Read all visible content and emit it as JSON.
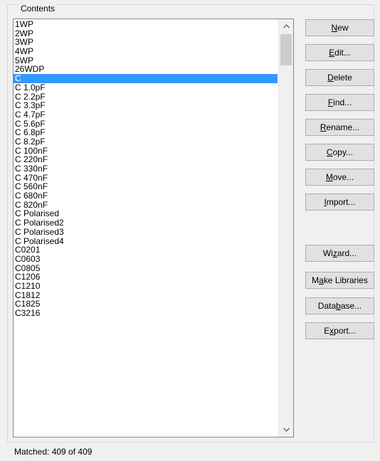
{
  "group": {
    "title": "Contents"
  },
  "list": {
    "items": [
      "1WP",
      "2WP",
      "3WP",
      "4WP",
      "5WP",
      "26WDP",
      "C",
      "C 1.0pF",
      "C 2.2pF",
      "C 3.3pF",
      "C 4.7pF",
      "C 5.6pF",
      "C 6.8pF",
      "C 8.2pF",
      "C 100nF",
      "C 220nF",
      "C 330nF",
      "C 470nF",
      "C 560nF",
      "C 680nF",
      "C 820nF",
      "C Polarised",
      "C Polarised2",
      "C Polarised3",
      "C Polarised4",
      "C0201",
      "C0603",
      "C0805",
      "C1206",
      "C1210",
      "C1812",
      "C1825",
      "C3216"
    ],
    "selected_index": 6,
    "selected_color": "#3399ff"
  },
  "scrollbar": {
    "up_icon": "chevron-up-icon",
    "down_icon": "chevron-down-icon"
  },
  "buttons": [
    {
      "pre": "",
      "acc": "N",
      "post": "ew"
    },
    {
      "pre": "",
      "acc": "E",
      "post": "dit..."
    },
    {
      "pre": "",
      "acc": "D",
      "post": "elete"
    },
    {
      "pre": "",
      "acc": "F",
      "post": "ind..."
    },
    {
      "pre": "",
      "acc": "R",
      "post": "ename..."
    },
    {
      "pre": "",
      "acc": "C",
      "post": "opy..."
    },
    {
      "pre": "",
      "acc": "M",
      "post": "ove..."
    },
    {
      "pre": "",
      "acc": "I",
      "post": "mport..."
    },
    {
      "pre": "Wi",
      "acc": "z",
      "post": "ard..."
    },
    {
      "pre": "M",
      "acc": "a",
      "post": "ke Libraries"
    },
    {
      "pre": "Data",
      "acc": "b",
      "post": "ase..."
    },
    {
      "pre": "E",
      "acc": "x",
      "post": "port..."
    }
  ],
  "status": {
    "text": "Matched: 409 of 409"
  }
}
